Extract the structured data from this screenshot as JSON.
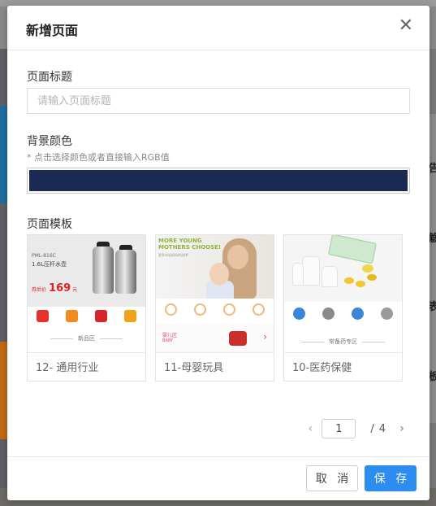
{
  "modal": {
    "title": "新增页面",
    "close_icon": "close-icon"
  },
  "page_title_field": {
    "label": "页面标题",
    "value": "",
    "placeholder": "请输入页面标题"
  },
  "background_color_field": {
    "label": "背景颜色",
    "hint": "* 点击选择颜色或者直接输入RGB值",
    "value": "#1b2a52"
  },
  "template_section": {
    "label": "页面模板",
    "templates": [
      {
        "name": "12- 通用行业",
        "thumb": {
          "line1": "PML-816C",
          "line2": "1.6L压杆水壶",
          "price_prefix": "券后价",
          "price": "169",
          "price_suffix": "元",
          "section": "新品区"
        }
      },
      {
        "name": "11-母婴玩具",
        "thumb": {
          "headline": "MORE YOUNG MOTHERS CHOOSE!",
          "subline": "更多年轻妈妈的选择!",
          "section": "婴儿区",
          "section_sub": "BABY"
        }
      },
      {
        "name": "10-医药保健",
        "thumb": {
          "section": "常备药专区"
        }
      }
    ]
  },
  "pagination": {
    "current": "1",
    "separator": "/",
    "total": "4"
  },
  "footer": {
    "cancel_label": "取 消",
    "save_label": "保 存"
  },
  "backdrop": {
    "right_glyphs": [
      "告",
      "觞",
      "表",
      "板"
    ]
  }
}
